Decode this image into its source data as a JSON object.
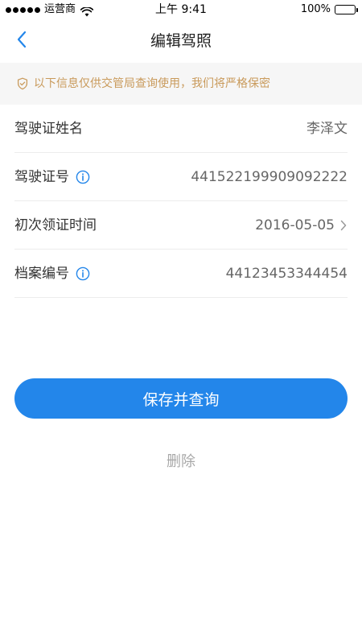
{
  "status_bar": {
    "carrier": "运营商",
    "time": "上午 9:41",
    "battery": "100%"
  },
  "nav": {
    "title": "编辑驾照",
    "back_icon": "chevron-left-icon"
  },
  "notice": {
    "icon": "shield-icon",
    "text": "以下信息仅供交管局查询使用，我们将严格保密"
  },
  "form": {
    "rows": [
      {
        "label": "驾驶证姓名",
        "value": "李泽文"
      },
      {
        "label": "驾驶证号",
        "value": "441522199909092222",
        "info_icon": true
      },
      {
        "label": "初次领证时间",
        "value": "2016-05-05",
        "chevron": true
      },
      {
        "label": "档案编号",
        "value": "44123453344454",
        "info_icon": true
      }
    ]
  },
  "actions": {
    "save_label": "保存并查询",
    "delete_label": "删除"
  },
  "colors": {
    "primary": "#2386ea",
    "notice_text": "#c99a5b",
    "notice_bg": "#f6f6f6"
  }
}
